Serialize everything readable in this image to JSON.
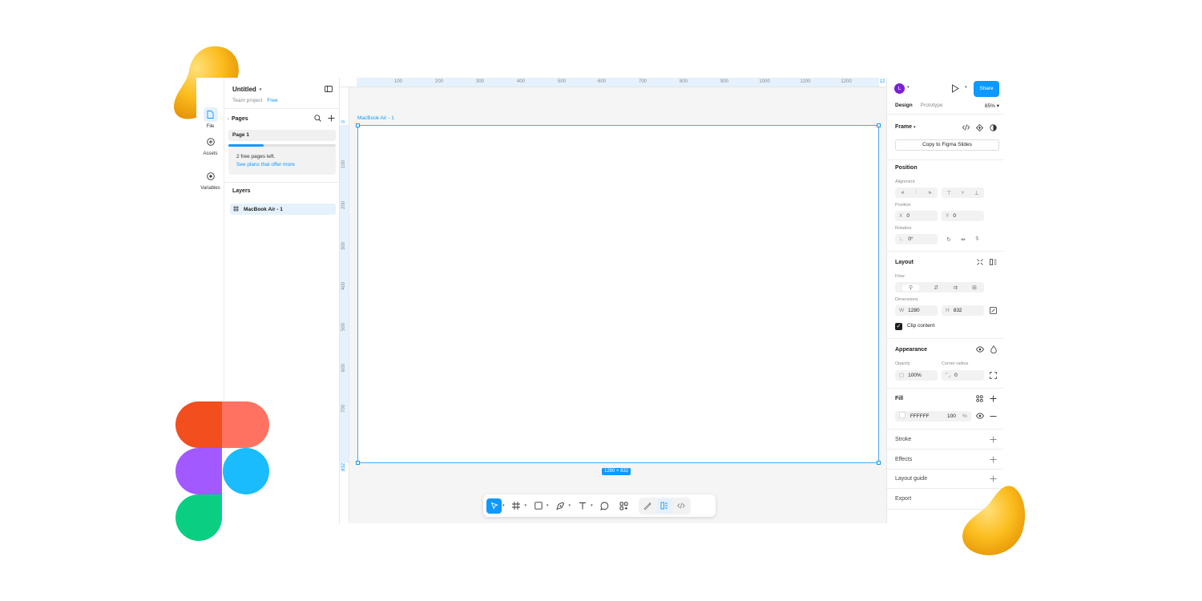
{
  "rail": {
    "file": "File",
    "assets": "Assets",
    "variables": "Variables"
  },
  "file": {
    "title": "Untitled",
    "project": "Team project",
    "plan": "Free"
  },
  "pages": {
    "heading": "Pages",
    "current": "Page 1",
    "free_pages_progress": 0.33,
    "free_left": "2 free pages left.",
    "plans_link": "See plans that offer more"
  },
  "layers": {
    "heading": "Layers",
    "items": [
      "MacBook Air - 1"
    ]
  },
  "canvas": {
    "ruler_x": [
      "100",
      "200",
      "300",
      "400",
      "500",
      "600",
      "700",
      "800",
      "900",
      "1000",
      "1100",
      "1200",
      "12"
    ],
    "ruler_y": [
      "0",
      "100",
      "200",
      "300",
      "400",
      "500",
      "600",
      "700",
      "832"
    ],
    "frame_name": "MacBook Air - 1",
    "frame_size": "1280 × 832"
  },
  "right": {
    "avatar": "L",
    "share": "Share",
    "tab_design": "Design",
    "tab_prototype": "Prototype",
    "zoom": "85%",
    "frame": "Frame",
    "copy_slides": "Copy to Figma Slides",
    "position_heading": "Position",
    "alignment_label": "Alignment",
    "position_label": "Position",
    "x_key": "X",
    "x_val": "0",
    "y_key": "Y",
    "y_val": "0",
    "rotation_label": "Rotation",
    "rotation_val": "0°",
    "layout_heading": "Layout",
    "flow_label": "Flow",
    "dimensions_label": "Dimensions",
    "w_key": "W",
    "w_val": "1280",
    "h_key": "H",
    "h_val": "832",
    "clip_content": "Clip content",
    "appearance_heading": "Appearance",
    "opacity_label": "Opacity",
    "opacity_val": "100%",
    "corner_label": "Corner radius",
    "corner_val": "0",
    "fill_heading": "Fill",
    "fill_hex": "FFFFFF",
    "fill_opacity": "100",
    "fill_pct": "%",
    "stroke": "Stroke",
    "effects": "Effects",
    "layout_guide": "Layout guide",
    "export": "Export"
  },
  "colors": {
    "accent": "#0d99ff",
    "avatar": "#7b1fd6",
    "logo_red": "#f24e1e",
    "logo_coral": "#ff7262",
    "logo_purple": "#a259ff",
    "logo_blue": "#1abcfe",
    "logo_green": "#0acf83",
    "blob": "#f7b500"
  }
}
